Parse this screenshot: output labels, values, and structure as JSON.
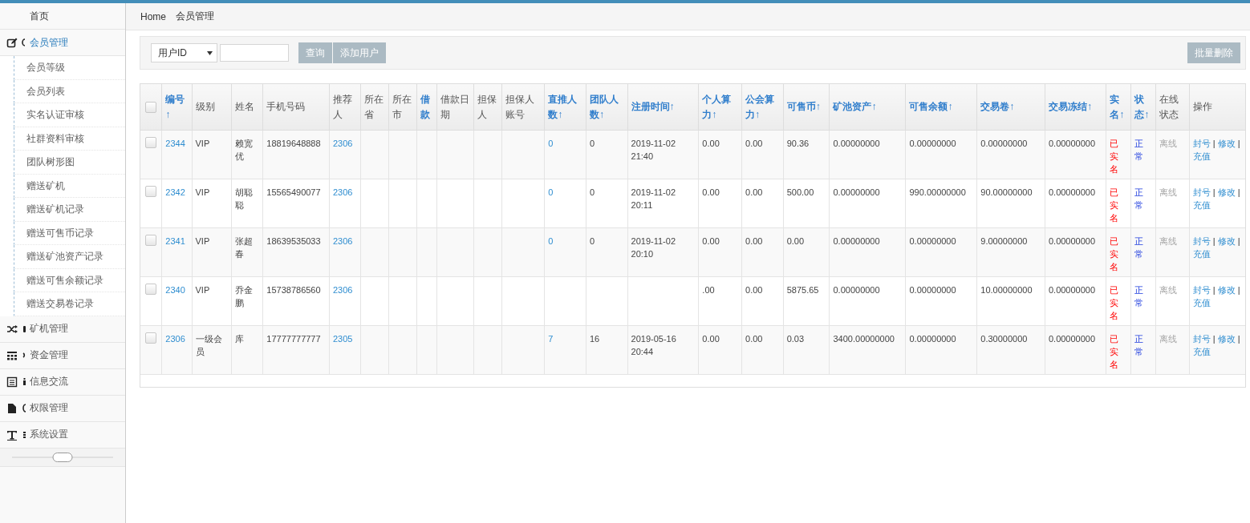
{
  "sidebar": {
    "home": "首页",
    "menus": [
      {
        "label": "会员管理",
        "expanded": true,
        "children": [
          {
            "label": "会员等级"
          },
          {
            "label": "会员列表"
          },
          {
            "label": "实名认证审核"
          },
          {
            "label": "社群资料审核"
          },
          {
            "label": "团队树形图"
          },
          {
            "label": "赠送矿机"
          },
          {
            "label": "赠送矿机记录"
          },
          {
            "label": "赠送可售币记录"
          },
          {
            "label": "赠送矿池资产记录"
          },
          {
            "label": "赠送可售余额记录"
          },
          {
            "label": "赠送交易卷记录"
          }
        ]
      },
      {
        "label": "矿机管理",
        "expanded": false
      },
      {
        "label": "资金管理",
        "expanded": false
      },
      {
        "label": "信息交流",
        "expanded": false
      },
      {
        "label": "权限管理",
        "expanded": false
      },
      {
        "label": "系统设置",
        "expanded": false
      }
    ]
  },
  "breadcrumb": [
    "Home",
    "会员管理"
  ],
  "toolbar": {
    "search_field": {
      "value": "用户ID"
    },
    "buttons": [
      "查询",
      "添加用户"
    ],
    "bulk_delete": "批量删除"
  },
  "table": {
    "select_all": {
      "checked": false
    },
    "columns": [
      {
        "label": "编号↑",
        "sortable": true
      },
      {
        "label": "级别",
        "sortable": false
      },
      {
        "label": "姓名",
        "sortable": false
      },
      {
        "label": "手机号码",
        "sortable": false
      },
      {
        "label": "推荐人",
        "sortable": false
      },
      {
        "label": "所在省",
        "sortable": false
      },
      {
        "label": "所在市",
        "sortable": false
      },
      {
        "label": "借款",
        "sortable": true
      },
      {
        "label": "借款日期",
        "sortable": false
      },
      {
        "label": "担保人",
        "sortable": false
      },
      {
        "label": "担保人账号",
        "sortable": false
      },
      {
        "label": "直推人数↑",
        "sortable": true
      },
      {
        "label": "团队人数↑",
        "sortable": true
      },
      {
        "label": "注册时间↑",
        "sortable": true
      },
      {
        "label": "个人算力↑",
        "sortable": true
      },
      {
        "label": "公会算力↑",
        "sortable": true
      },
      {
        "label": "可售币↑",
        "sortable": true
      },
      {
        "label": "矿池资产↑",
        "sortable": true
      },
      {
        "label": "可售余额↑",
        "sortable": true
      },
      {
        "label": "交易卷↑",
        "sortable": true
      },
      {
        "label": "交易冻结↑",
        "sortable": true
      },
      {
        "label": "实名↑",
        "sortable": true
      },
      {
        "label": "状态↑",
        "sortable": true
      },
      {
        "label": "在线状态",
        "sortable": false
      },
      {
        "label": "操作",
        "sortable": false
      }
    ],
    "rows": [
      {
        "checked": false,
        "cells": [
          "2344",
          "VIP",
          "赖宽优",
          "18819648888",
          "2306",
          null,
          null,
          null,
          null,
          null,
          null,
          "0",
          "0",
          "2019-11-02 21:40",
          "0.00",
          "0.00",
          "90.36",
          "0.00000000",
          "0.00000000",
          "0.00000000",
          "0.00000000",
          "已实名",
          "正常",
          "离线"
        ],
        "actions": [
          "封号",
          "|",
          "修改",
          "|",
          "充值"
        ]
      },
      {
        "checked": false,
        "cells": [
          "2342",
          "VIP",
          "胡聪聪",
          "15565490077",
          "2306",
          null,
          null,
          null,
          null,
          null,
          null,
          "0",
          "0",
          "2019-11-02 20:11",
          "0.00",
          "0.00",
          "500.00",
          "0.00000000",
          "990.00000000",
          "90.00000000",
          "0.00000000",
          "已实名",
          "正常",
          "离线"
        ],
        "actions": [
          "封号",
          "|",
          "修改",
          "|",
          "充值"
        ]
      },
      {
        "checked": false,
        "cells": [
          "2341",
          "VIP",
          "张超春",
          "18639535033",
          "2306",
          null,
          null,
          null,
          null,
          null,
          null,
          "0",
          "0",
          "2019-11-02 20:10",
          "0.00",
          "0.00",
          "0.00",
          "0.00000000",
          "0.00000000",
          "9.00000000",
          "0.00000000",
          "已实名",
          "正常",
          "离线"
        ],
        "actions": [
          "封号",
          "|",
          "修改",
          "|",
          "充值"
        ]
      },
      {
        "checked": false,
        "cells": [
          "2340",
          "VIP",
          "乔金鹏",
          "15738786560",
          "2306",
          null,
          null,
          null,
          null,
          null,
          null,
          null,
          null,
          null,
          ".00",
          "0.00",
          "5875.65",
          "0.00000000",
          "0.00000000",
          "10.00000000",
          "0.00000000",
          "已实名",
          "正常",
          "离线"
        ],
        "actions": [
          "封号",
          "|",
          "修改",
          "|",
          "充值"
        ]
      },
      {
        "checked": false,
        "cells": [
          "2306",
          "一级会员",
          "库",
          "17777777777",
          "2305",
          null,
          null,
          null,
          null,
          null,
          null,
          "7",
          "16",
          "2019-05-16 20:44",
          "0.00",
          "0.00",
          "0.03",
          "3400.00000000",
          "0.00000000",
          "0.30000000",
          "0.00000000",
          "已实名",
          "正常",
          "离线"
        ],
        "actions": [
          "封号",
          "|",
          "修改",
          "|",
          "充值"
        ]
      }
    ]
  }
}
